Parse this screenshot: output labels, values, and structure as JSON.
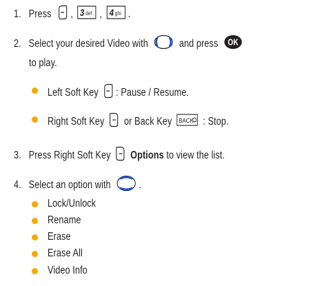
{
  "accent_color": "#f5a800",
  "steps": [
    {
      "number": "1.",
      "text": "Press",
      "sep1": ",",
      "sep2": ",",
      "end": "."
    },
    {
      "number": "2.",
      "text_a": "Select your desired Video with",
      "text_b": "and press",
      "text_c": "to play."
    },
    {
      "number": "3.",
      "text_a": "Press Right Soft Key",
      "bold": "Options",
      "text_b": "to view the list."
    },
    {
      "number": "4.",
      "text_a": "Select an option with",
      "end": "."
    }
  ],
  "sub_bullets": [
    {
      "text_a": "Left Soft Key",
      "text_b": ": Pause / Resume."
    },
    {
      "text_a": "Right Soft Key",
      "text_b": "or Back Key",
      "text_c": ": Stop."
    }
  ],
  "options": [
    "Lock/Unlock",
    "Rename",
    "Erase",
    "Erase All",
    "Video Info"
  ],
  "keys": {
    "key3_num": "3",
    "key3_letters": "def",
    "key4_num": "4",
    "key4_letters": "ghi",
    "ok": "OK",
    "back": "BACK"
  },
  "icons": [
    "left-soft-key-icon",
    "right-soft-key-icon",
    "nav-key-icon",
    "ok-key-icon",
    "back-key-icon",
    "key-3-def-icon",
    "key-4-ghi-icon"
  ]
}
